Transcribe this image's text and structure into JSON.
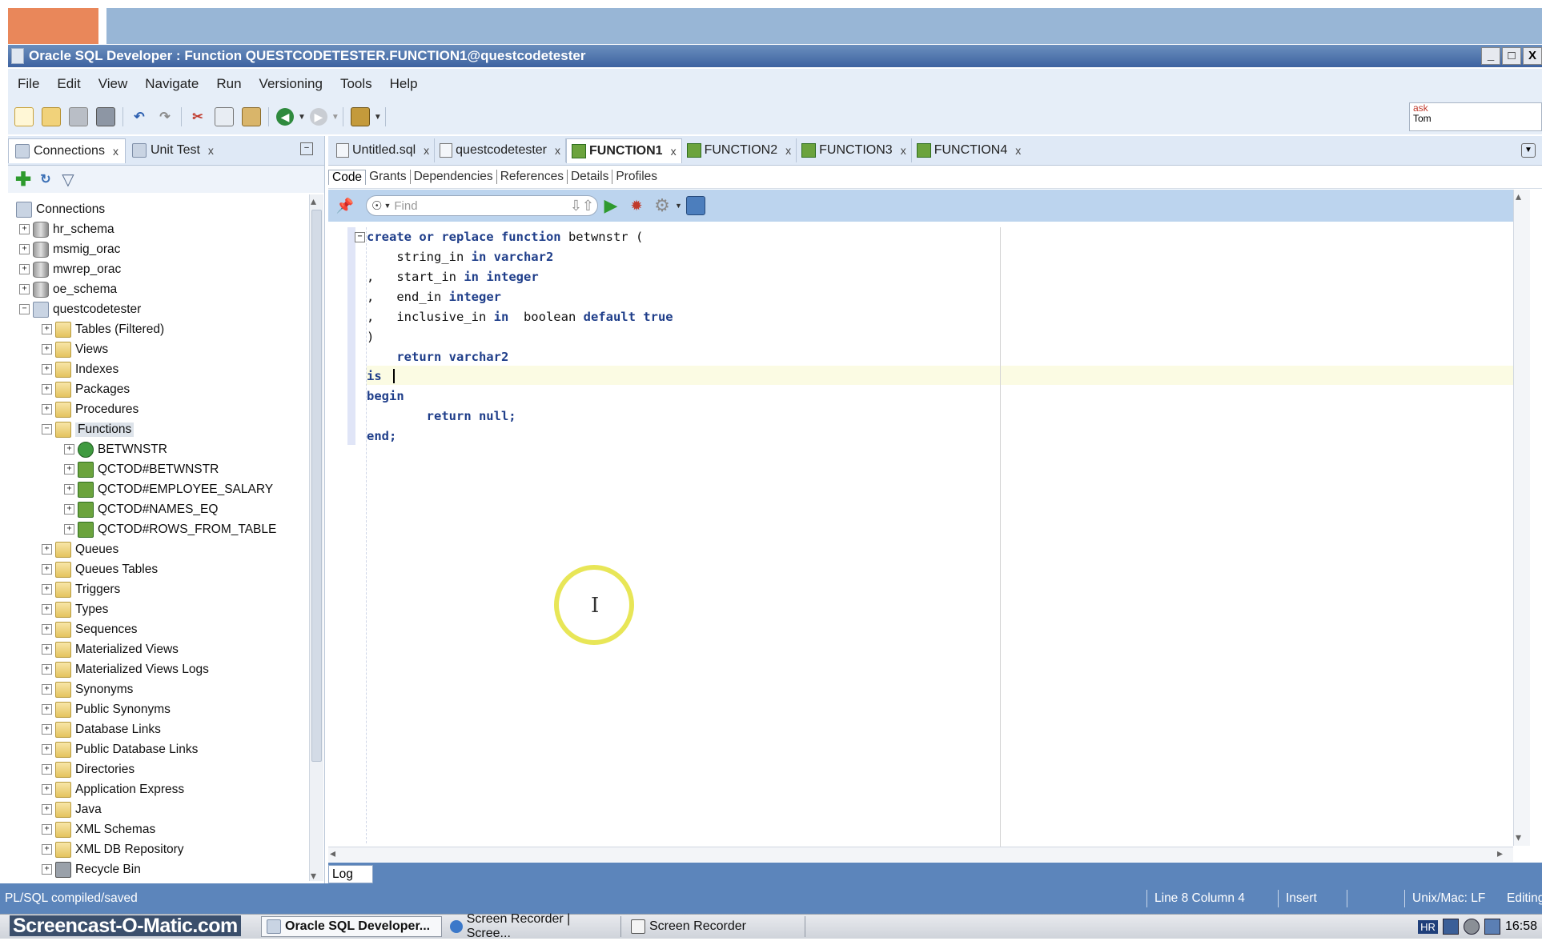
{
  "window": {
    "title": "Oracle SQL Developer : Function QUESTCODETESTER.FUNCTION1@questcodetester",
    "controls": [
      "_",
      "□",
      "X"
    ]
  },
  "menu": [
    "File",
    "Edit",
    "View",
    "Navigate",
    "Run",
    "Versioning",
    "Tools",
    "Help"
  ],
  "asktom": {
    "line1": "ask",
    "line2": "Tom"
  },
  "left_tabs": [
    {
      "label": "Connections",
      "close": "x"
    },
    {
      "label": "Unit Test",
      "close": "x"
    }
  ],
  "tree": {
    "root": "Connections",
    "connections": [
      "hr_schema",
      "msmig_orac",
      "mwrep_orac",
      "oe_schema",
      "questcodetester"
    ],
    "categories_before": [
      "Tables (Filtered)",
      "Views",
      "Indexes",
      "Packages",
      "Procedures"
    ],
    "functions_label": "Functions",
    "functions": [
      "BETWNSTR",
      "QCTOD#BETWNSTR",
      "QCTOD#EMPLOYEE_SALARY",
      "QCTOD#NAMES_EQ",
      "QCTOD#ROWS_FROM_TABLE"
    ],
    "categories_after": [
      "Queues",
      "Queues Tables",
      "Triggers",
      "Types",
      "Sequences",
      "Materialized Views",
      "Materialized Views Logs",
      "Synonyms",
      "Public Synonyms",
      "Database Links",
      "Public Database Links",
      "Directories",
      "Application Express",
      "Java",
      "XML Schemas",
      "XML DB Repository",
      "Recycle Bin"
    ]
  },
  "editor_tabs": [
    {
      "label": "Untitled.sql",
      "close": "x"
    },
    {
      "label": "questcodetester",
      "close": "x"
    },
    {
      "label": "FUNCTION1",
      "close": "x"
    },
    {
      "label": "FUNCTION2",
      "close": "x"
    },
    {
      "label": "FUNCTION3",
      "close": "x"
    },
    {
      "label": "FUNCTION4",
      "close": "x"
    }
  ],
  "sub_tabs": [
    "Code",
    "Grants",
    "Dependencies",
    "References",
    "Details",
    "Profiles"
  ],
  "find": {
    "placeholder": "Find"
  },
  "code": {
    "l1a": "create or replace function",
    "l1b": " betwnstr (",
    "l2a": "    string_in ",
    "l2b": "in varchar2",
    "l3a": ",   start_in ",
    "l3b": "in integer",
    "l4a": ",   end_in ",
    "l4b": "integer",
    "l5a": ",   inclusive_in ",
    "l5b": "in",
    "l5c": "  boolean ",
    "l5d": "default true",
    "l6": ")",
    "l7": "    return varchar2",
    "l8": "is ",
    "l9": "begin",
    "l10": "        return null;",
    "l11": "end;"
  },
  "log_tab": "Log",
  "status": {
    "message": "PL/SQL compiled/saved",
    "position": "Line 8 Column 4",
    "mode": "Insert",
    "line_endings": "Unix/Mac: LF",
    "state": "Editing"
  },
  "taskbar": {
    "brand": "Screencast-O-Matic.com",
    "tasks": [
      "Oracle SQL Developer...",
      "Screen Recorder | Scree...",
      "Screen Recorder"
    ],
    "lang": "HR",
    "time": "16:58"
  }
}
